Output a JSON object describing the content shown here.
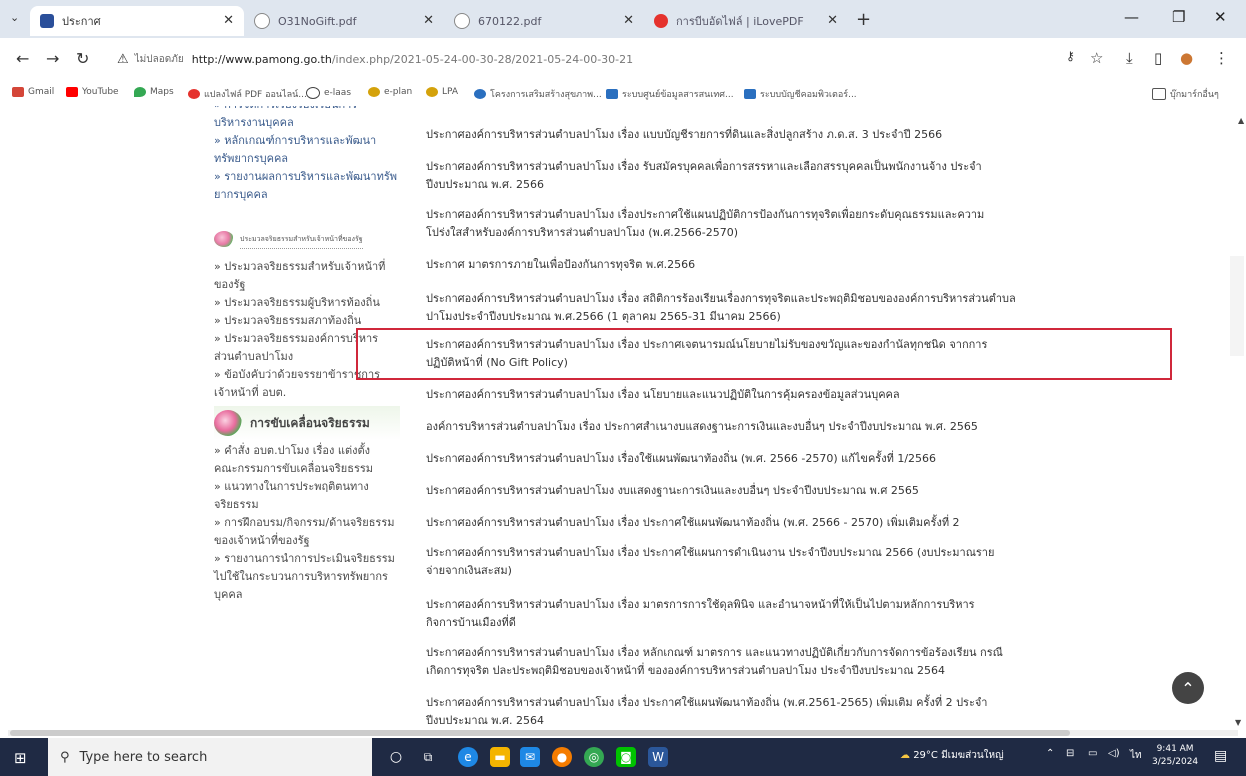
{
  "browser": {
    "tabs": [
      {
        "title": "ประกาศ",
        "favicon_color": "#2a4f9a"
      },
      {
        "title": "O31NoGift.pdf",
        "favicon_color": "#888888"
      },
      {
        "title": "670122.pdf",
        "favicon_color": "#888888"
      },
      {
        "title": "การบีบอัดไฟล์ | iLovePDF",
        "favicon_color": "#e5322d"
      }
    ],
    "new_tab": "+",
    "security_label": "ไม่ปลอดภัย",
    "url_host": "http://www.pamong.go.th",
    "url_path": "/index.php/2021-05-24-00-30-28/2021-05-24-00-30-21",
    "bookmarks": [
      {
        "label": "Gmail",
        "color": "#d44638"
      },
      {
        "label": "YouTube",
        "color": "#ff0000"
      },
      {
        "label": "Maps",
        "color": "#34a853"
      },
      {
        "label": "แปลงไฟล์ PDF ออนไลน์...",
        "color": "#e5322d"
      },
      {
        "label": "e-laas",
        "color": "#444444"
      },
      {
        "label": "e-plan",
        "color": "#d4a20b"
      },
      {
        "label": "LPA",
        "color": "#d4a20b"
      },
      {
        "label": "โครงการเสริมสร้างสุขภาพ...",
        "color": "#2a6fbf"
      },
      {
        "label": "ระบบศูนย์ข้อมูลสารสนเทศ...",
        "color": "#2a6fbf"
      },
      {
        "label": "ระบบบัญชีคอมพิวเตอร์...",
        "color": "#2a6fbf"
      }
    ],
    "bookmarks_folder": "บุ๊กมาร์กอื่นๆ"
  },
  "sidebar": {
    "top_links": [
      "» การจัดการเรื่องร้องเรียนการ",
      "บริหารงานบุคคล",
      "» หลักเกณฑ์การบริหารและพัฒนา",
      "ทรัพยากรบุคคล",
      "» รายงานผลการบริหารและพัฒนาทรัพ",
      "ยากรบุคคล"
    ],
    "banner1": "ประมวลจริยธรรมสำหรับเจ้าหน้าที่ของรัฐ",
    "ethics_links": [
      "» ประมวลจริยธรรมสำหรับเจ้าหน้าที่",
      "ของรัฐ",
      "» ประมวลจริยธรรมผู้บริหารท้องถิ่น",
      "» ประมวลจริยธรรมสภาท้องถิ่น",
      "» ประมวลจริยธรรมองค์การบริหาร",
      "ส่วนตำบลปาโมง",
      "» ข้อบังคับว่าด้วยจรรยาข้าราชการ",
      "เจ้าหน้าที่ อบต."
    ],
    "banner2": "การขับเคลื่อนจริยธรรม",
    "drive_links": [
      "» คำสั่ง อบต.ปาโมง เรื่อง แต่งตั้ง",
      "คณะกรรมการขับเคลื่อนจริยธรรม",
      "» แนวทางในการประพฤติตนทาง",
      "จริยธรรม",
      "» การฝึกอบรม/กิจกรรม/ด้านจริยธรรม",
      "ของเจ้าหน้าที่ของรัฐ",
      "» รายงานการนำการประเมินจริยธรรม",
      "ไปใช้ในกระบวนการบริหารทรัพยากร",
      "บุคคล"
    ]
  },
  "announcements": [
    {
      "lines": [
        "ประกาศองค์การบริหารส่วนตำบลปาโมง เรื่อง แบบบัญชีรายการที่ดินและสิ่งปลูกสร้าง ภ.ด.ส. 3 ประจำปี 2566"
      ]
    },
    {
      "lines": [
        "ประกาศองค์การบริหารส่วนตำบลปาโมง เรื่อง รับสมัครบุคคลเพื่อการสรรหาและเลือกสรรบุคคลเป็นพนักงานจ้าง ประจำ",
        "ปีงบประมาณ พ.ศ. 2566"
      ]
    },
    {
      "lines": [
        "ประกาศองค์การบริหารส่วนตำบลปาโมง เรื่องประกาศใช้แผนปฏิบัติการป้องกันการทุจริตเพื่อยกระดับคุณธรรมและความ",
        "โปร่งใสสำหรับองค์การบริหารส่วนตำบลปาโมง (พ.ศ.2566-2570)"
      ]
    },
    {
      "lines": [
        "ประกาศ มาตรการภายในเพื่อป้องกันการทุจริต พ.ศ.2566"
      ]
    },
    {
      "lines": [
        "ประกาศองค์การบริหารส่วนตำบลปาโมง เรื่อง สถิติการร้องเรียนเรื่องการทุจริตและประพฤติมิชอบขององค์การบริหารส่วนตำบล",
        "ปาโมงประจำปีงบประมาณ พ.ศ.2566 (1 ตุลาคม 2565-31 มีนาคม 2566)"
      ]
    },
    {
      "lines": [
        "ประกาศองค์การบริหารส่วนตำบลปาโมง เรื่อง ประกาศเจตนารมณ์นโยบายไม่รับของขวัญและของกำนัลทุกชนิด จากการ",
        "ปฏิบัติหน้าที่ (No Gift Policy)"
      ]
    },
    {
      "lines": [
        "ประกาศองค์การบริหารส่วนตำบลปาโมง เรื่อง นโยบายและแนวปฏิบัติในการคุ้มครองข้อมูลส่วนบุคคล"
      ]
    },
    {
      "lines": [
        "องค์การบริหารส่วนตำบลปาโมง เรื่อง ประกาศสำเนางบแสดงฐานะการเงินและงบอื่นๆ ประจำปีงบประมาณ พ.ศ. 2565"
      ]
    },
    {
      "lines": [
        "ประกาศองค์การบริหารส่วนตำบลปาโมง เรื่องใช้แผนพัฒนาท้องถิ่น (พ.ศ. 2566 -2570) แก้ไขครั้งที่ 1/2566"
      ]
    },
    {
      "lines": [
        "ประกาศองค์การบริหารส่วนตำบลปาโมง งบแสดงฐานะการเงินและงบอื่นๆ ประจำปีงบประมาณ พ.ศ 2565"
      ]
    },
    {
      "lines": [
        "ประกาศองค์การบริหารส่วนตำบลปาโมง เรื่อง ประกาศใช้แผนพัฒนาท้องถิ่น (พ.ศ. 2566 - 2570) เพิ่มเติมครั้งที่ 2"
      ]
    },
    {
      "lines": [
        "ประกาศองค์การบริหารส่วนตำบลปาโมง เรื่อง ประกาศใช้แผนการดำเนินงาน ประจำปีงบประมาณ 2566 (งบประมาณราย",
        "จ่ายจากเงินสะสม)"
      ]
    },
    {
      "lines": [
        "ประกาศองค์การบริหารส่วนตำบลปาโมง เรื่อง มาตรการการใช้ดุลพินิจ และอำนาจหน้าที่ให้เป็นไปตามหลักการบริหาร",
        "กิจการบ้านเมืองที่ดี"
      ]
    },
    {
      "lines": [
        "ประกาศองค์การบริหารส่วนตำบลปาโมง เรื่อง หลักเกณฑ์ มาตรการ และแนวทางปฏิบัติเกี่ยวกับการจัดการข้อร้องเรียน กรณี",
        "เกิดการทุจริต ปละประพฤติมิชอบของเจ้าหน้าที่ ขององค์การบริหารส่วนตำบลปาโมง ประจำปีงบประมาณ 2564"
      ]
    },
    {
      "lines": [
        "ประกาศองค์การบริหารส่วนตำบลปาโมง เรื่อง ประกาศใช้แผนพัฒนาท้องถิ่น (พ.ศ.2561-2565) เพิ่มเติม ครั้งที่ 2 ประจำ",
        "ปีงบประมาณ พ.ศ. 2564"
      ]
    }
  ],
  "highlight_color": "#d0283b",
  "taskbar": {
    "search_placeholder": "Type here to search",
    "weather": "29°C มีเมฆส่วนใหญ่",
    "time": "9:41 AM",
    "date": "3/25/2024"
  }
}
